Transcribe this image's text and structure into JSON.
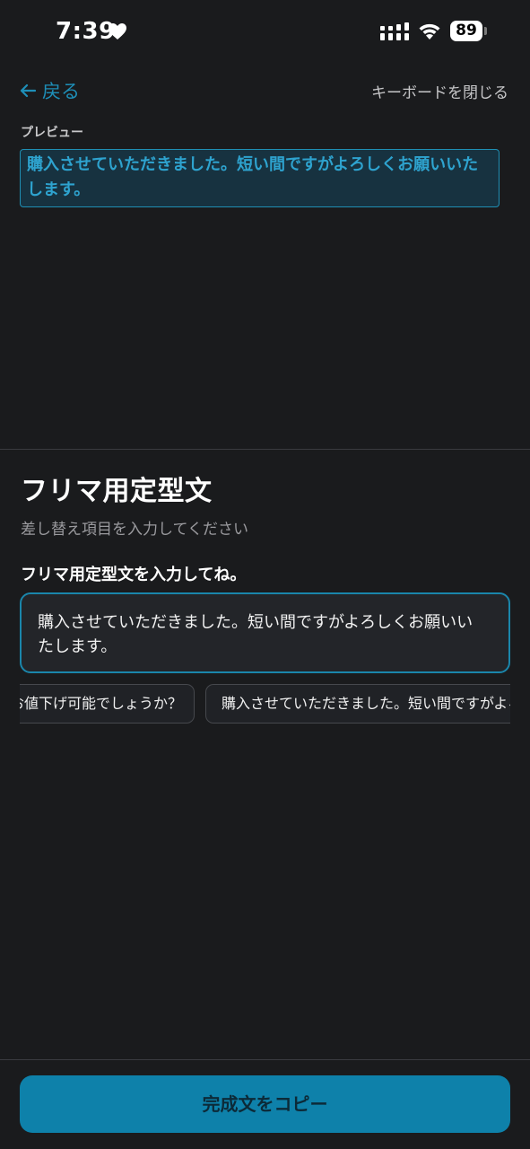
{
  "status_bar": {
    "time": "7:39",
    "battery": "89"
  },
  "nav": {
    "back_label": "戻る",
    "close_keyboard_label": "キーボードを閉じる"
  },
  "preview": {
    "label": "プレビュー",
    "text": "購入させていただきました。短い間ですがよろしくお願いいたします。"
  },
  "panel": {
    "title": "フリマ用定型文",
    "subtitle": "差し替え項目を入力してください",
    "field_label": "フリマ用定型文を入力してね。",
    "input_value": "購入させていただきました。短い間ですがよろしくお願いいたします。"
  },
  "chips": [
    {
      "label": "お値下げ可能でしょうか？"
    },
    {
      "label": "購入させていただきました。短い間ですがよろしくお願いいたします。"
    }
  ],
  "footer": {
    "copy_button_label": "完成文をコピー"
  },
  "colors": {
    "background": "#1a1b1d",
    "accent": "#1e8fb8",
    "button": "#0e81aa"
  }
}
